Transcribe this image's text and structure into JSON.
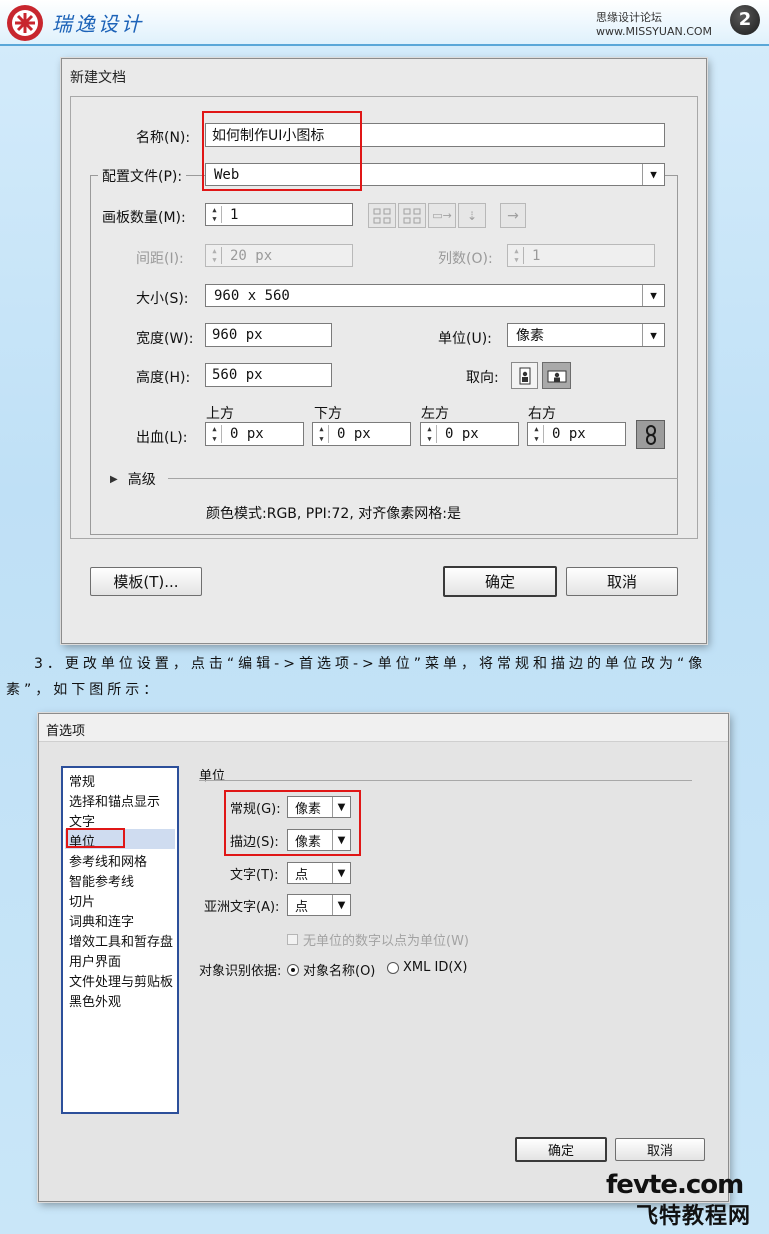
{
  "header": {
    "logo_text": "瑞逸设计",
    "site_text": "思缘设计论坛 www.MISSYUAN.COM",
    "page_number": "2"
  },
  "new_doc_dialog": {
    "title": "新建文档",
    "name_label": "名称(N):",
    "name_value": "如何制作UI小图标",
    "profile_label": "配置文件(P):",
    "profile_value": "Web",
    "artboards_label": "画板数量(M):",
    "artboards_value": "1",
    "spacing_label": "间距(I):",
    "spacing_value": "20 px",
    "columns_label": "列数(O):",
    "columns_value": "1",
    "size_label": "大小(S):",
    "size_value": "960 x 560",
    "width_label": "宽度(W):",
    "width_value": "960 px",
    "units_label": "单位(U):",
    "units_value": "像素",
    "height_label": "高度(H):",
    "height_value": "560 px",
    "orientation_label": "取向:",
    "bleed_label": "出血(L):",
    "bleed_top_label": "上方",
    "bleed_bottom_label": "下方",
    "bleed_left_label": "左方",
    "bleed_right_label": "右方",
    "bleed_top_value": "0 px",
    "bleed_bottom_value": "0 px",
    "bleed_left_value": "0 px",
    "bleed_right_value": "0 px",
    "advanced_label": "高级",
    "info_text": "颜色模式:RGB, PPI:72, 对齐像素网格:是",
    "templates_button": "模板(T)...",
    "ok_button": "确定",
    "cancel_button": "取消"
  },
  "caption": {
    "line1": "3．更改单位设置，点击“编辑->首选项->单位”菜单，将常规和描边的单位改为“像",
    "line2": "素”，如下图所示："
  },
  "prefs_dialog": {
    "title": "首选项",
    "categories": [
      "常规",
      "选择和锚点显示",
      "文字",
      "单位",
      "参考线和网格",
      "智能参考线",
      "切片",
      "词典和连字",
      "增效工具和暂存盘",
      "用户界面",
      "文件处理与剪贴板",
      "黑色外观"
    ],
    "section_title": "单位",
    "general_label": "常规(G):",
    "general_value": "像素",
    "stroke_label": "描边(S):",
    "stroke_value": "像素",
    "type_label": "文字(T):",
    "type_value": "点",
    "asian_type_label": "亚洲文字(A):",
    "asian_type_value": "点",
    "numbers_checkbox": "无单位的数字以点为单位(W)",
    "object_id_label": "对象识别依据:",
    "object_name_option": "对象名称(O)",
    "xml_id_option": "XML ID(X)",
    "ok_button": "确定",
    "cancel_button": "取消"
  },
  "watermark": {
    "line1": "fevte.com",
    "line2": "飞特教程网"
  }
}
